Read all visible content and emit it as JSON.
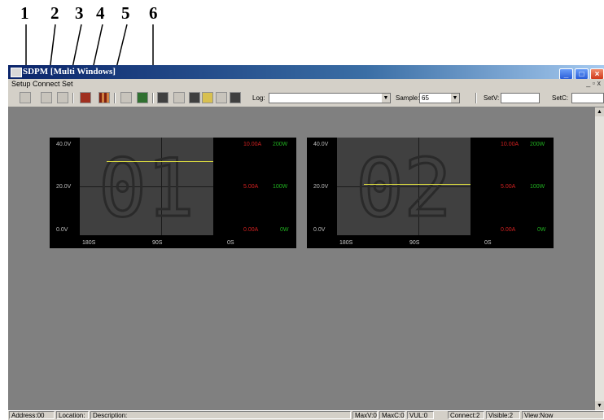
{
  "callouts": [
    "1",
    "2",
    "3",
    "4",
    "5",
    "6"
  ],
  "window": {
    "title": "SDPM [Multi Windows]",
    "menu_text": "Setup  Connect  Set",
    "mdi_controls": "_ ▫ x"
  },
  "toolbar": {
    "log_label": "Log:",
    "log_value": "",
    "sample_label": "Sample:",
    "sample_value": "65",
    "setv_label": "SetV:",
    "setv_value": "",
    "setc_label": "SetC:",
    "setc_value": ""
  },
  "panels": [
    {
      "digits": "01",
      "y_left": [
        "40.0V",
        "20.0V",
        "0.0V"
      ],
      "y_red": [
        "10.00A",
        "5.00A",
        "0.00A"
      ],
      "y_green": [
        "200W",
        "100W",
        "0W"
      ],
      "x_labels": [
        "180S",
        "90S",
        "0S"
      ],
      "trace_volts": 30.5
    },
    {
      "digits": "02",
      "y_left": [
        "40.0V",
        "20.0V",
        "0.0V"
      ],
      "y_red": [
        "10.00A",
        "5.00A",
        "0.00A"
      ],
      "y_green": [
        "200W",
        "100W",
        "0W"
      ],
      "x_labels": [
        "180S",
        "90S",
        "0S"
      ],
      "trace_volts": 21.0
    }
  ],
  "status": {
    "address": "Address:00",
    "location": "Location:",
    "description": "Description:",
    "maxv": "MaxV:0",
    "maxc": "MaxC:0",
    "vul": "VUL:0",
    "connect": "Connect:2",
    "visible": "Visible:2",
    "view": "View:Now"
  },
  "colors": {
    "titlebar": "#0a246a",
    "plot_bg": "#404040",
    "trace": "#e0e040",
    "current_scale": "#d02020",
    "power_scale": "#20b020"
  }
}
